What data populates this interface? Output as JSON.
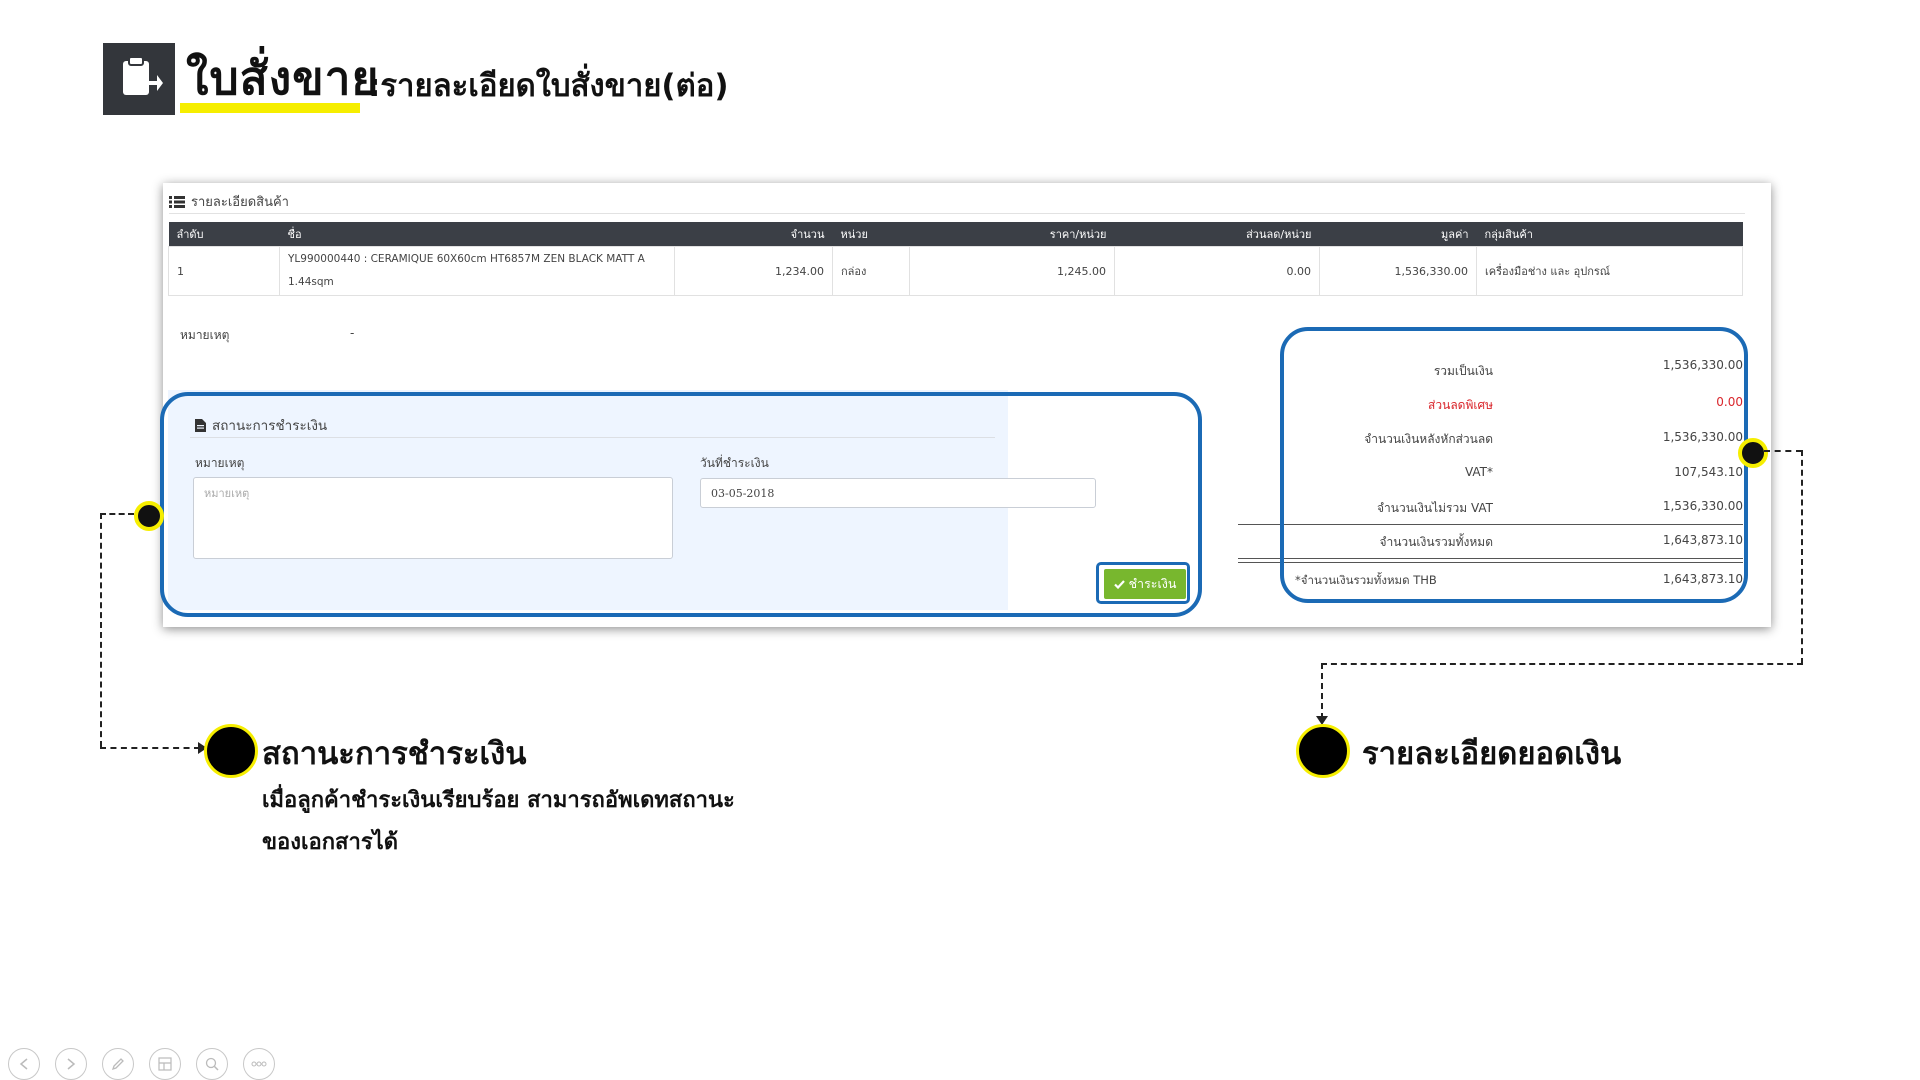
{
  "header": {
    "title": "ใบสั่งขาย",
    "subtitle": ":รายละเอียดใบสั่งขาย(ต่อ)",
    "icon": "clipboard-export-icon"
  },
  "product_section": {
    "title": "รายละเอียดสินค้า",
    "icon": "list-icon",
    "columns": [
      "ลำดับ",
      "ชื่อ",
      "จำนวน",
      "หน่วย",
      "ราคา/หน่วย",
      "ส่วนลด/หน่วย",
      "มูลค่า",
      "กลุ่มสินค้า"
    ],
    "rows": [
      {
        "no": "1",
        "name_line1": "YL990000440 : CERAMIQUE 60X60cm HT6857M ZEN BLACK MATT A",
        "name_line2": "1.44sqm",
        "qty": "1,234.00",
        "unit": "กล่อง",
        "price": "1,245.00",
        "discount": "0.00",
        "amount": "1,536,330.00",
        "group": "เครื่องมือช่าง และ อุปกรณ์"
      }
    ],
    "remark_label": "หมายเหตุ",
    "remark_value": "-"
  },
  "payment": {
    "title": "สถานะการชำระเงิน",
    "icon": "file-icon",
    "note_label": "หมายเหตุ",
    "note_placeholder": "หมายเหตุ",
    "date_label": "วันที่ชำระเงิน",
    "date_value": "03-05-2018",
    "pay_button": "ชำระเงิน",
    "pay_icon": "check-icon"
  },
  "totals": [
    {
      "label": "รวมเป็นเงิน",
      "value": "1,536,330.00",
      "color": "#444444"
    },
    {
      "label": "ส่วนลดพิเศษ",
      "value": "0.00",
      "color": "#d9262c"
    },
    {
      "label": "จำนวนเงินหลังหักส่วนลด",
      "value": "1,536,330.00",
      "color": "#444444"
    },
    {
      "label": "VAT*",
      "value": "107,543.10",
      "color": "#444444"
    },
    {
      "label": "จำนวนเงินไม่รวม VAT",
      "value": "1,536,330.00",
      "color": "#444444"
    },
    {
      "label": "จำนวนเงินรวมทั้งหมด",
      "value": "1,643,873.10",
      "color": "#444444"
    },
    {
      "label": "*จำนวนเงินรวมทั้งหมด THB",
      "value": "1,643,873.10",
      "color": "#444444"
    }
  ],
  "annotations": {
    "payment_status": {
      "title": "สถานะการชำระเงิน",
      "desc_line1": "เมื่อลูกค้าชำระเงินเรียบร้อย สามารถอัพเดทสถานะ",
      "desc_line2": "ของเอกสารได้"
    },
    "amount_detail": {
      "title": "รายละเอียดยอดเงิน"
    }
  },
  "colors": {
    "highlight": "#1b6ab5",
    "accent_yellow": "#f6ee00",
    "pay_button": "#78b72e",
    "table_header": "#3b3f46"
  },
  "toolbar": {
    "icons": [
      "prev-icon",
      "next-icon",
      "pen-icon",
      "slides-icon",
      "zoom-icon",
      "more-icon"
    ]
  }
}
